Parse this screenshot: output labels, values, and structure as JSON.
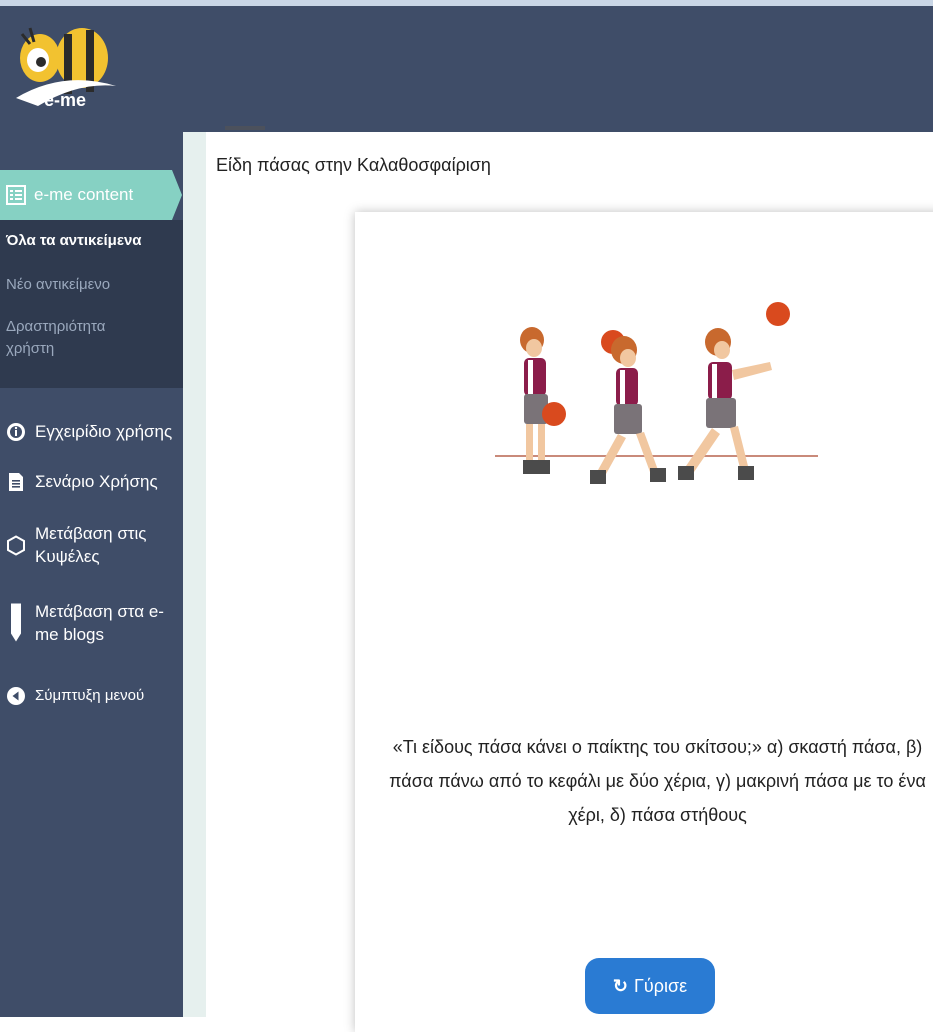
{
  "header": {
    "logo_text": "e-me"
  },
  "sidebar": {
    "active_item": {
      "label": "e-me content",
      "icon": "list-icon"
    },
    "submenu": [
      {
        "label": "Όλα τα αντικείμενα"
      },
      {
        "label": "Νέο αντικείμενο"
      },
      {
        "label": "Δραστηριότητα χρήστη"
      }
    ],
    "items": [
      {
        "label": "Εγχειρίδιο χρήσης",
        "icon": "info-icon"
      },
      {
        "label": "Σενάριο Χρήσης",
        "icon": "document-icon"
      },
      {
        "label": "Μετάβαση στις Κυψέλες",
        "icon": "hexagon-icon"
      },
      {
        "label": "Μετάβαση στα e-me blogs",
        "icon": "pen-icon"
      },
      {
        "label": "Σύμπτυξη μενού",
        "icon": "collapse-icon"
      }
    ]
  },
  "main": {
    "title": "Είδη πάσας στην Καλαθοσφαίριση",
    "card": {
      "question": "«Τι είδους πάσα κάνει ο παίκτης του σκίτσου;» α) σκαστή πάσα, β) πάσα πάνω από το κεφάλι με δύο χέρια, γ) μακρινή πάσα με το ένα χέρι, δ) πάσα στήθους",
      "flip_button": "Γύρισε",
      "flip_icon": "refresh-icon"
    }
  },
  "colors": {
    "header": "#3f4d68",
    "sidebar": "#3f4d68",
    "active": "#86d1c3",
    "submenu": "#2f3a4f",
    "button": "#2a7bd3"
  }
}
